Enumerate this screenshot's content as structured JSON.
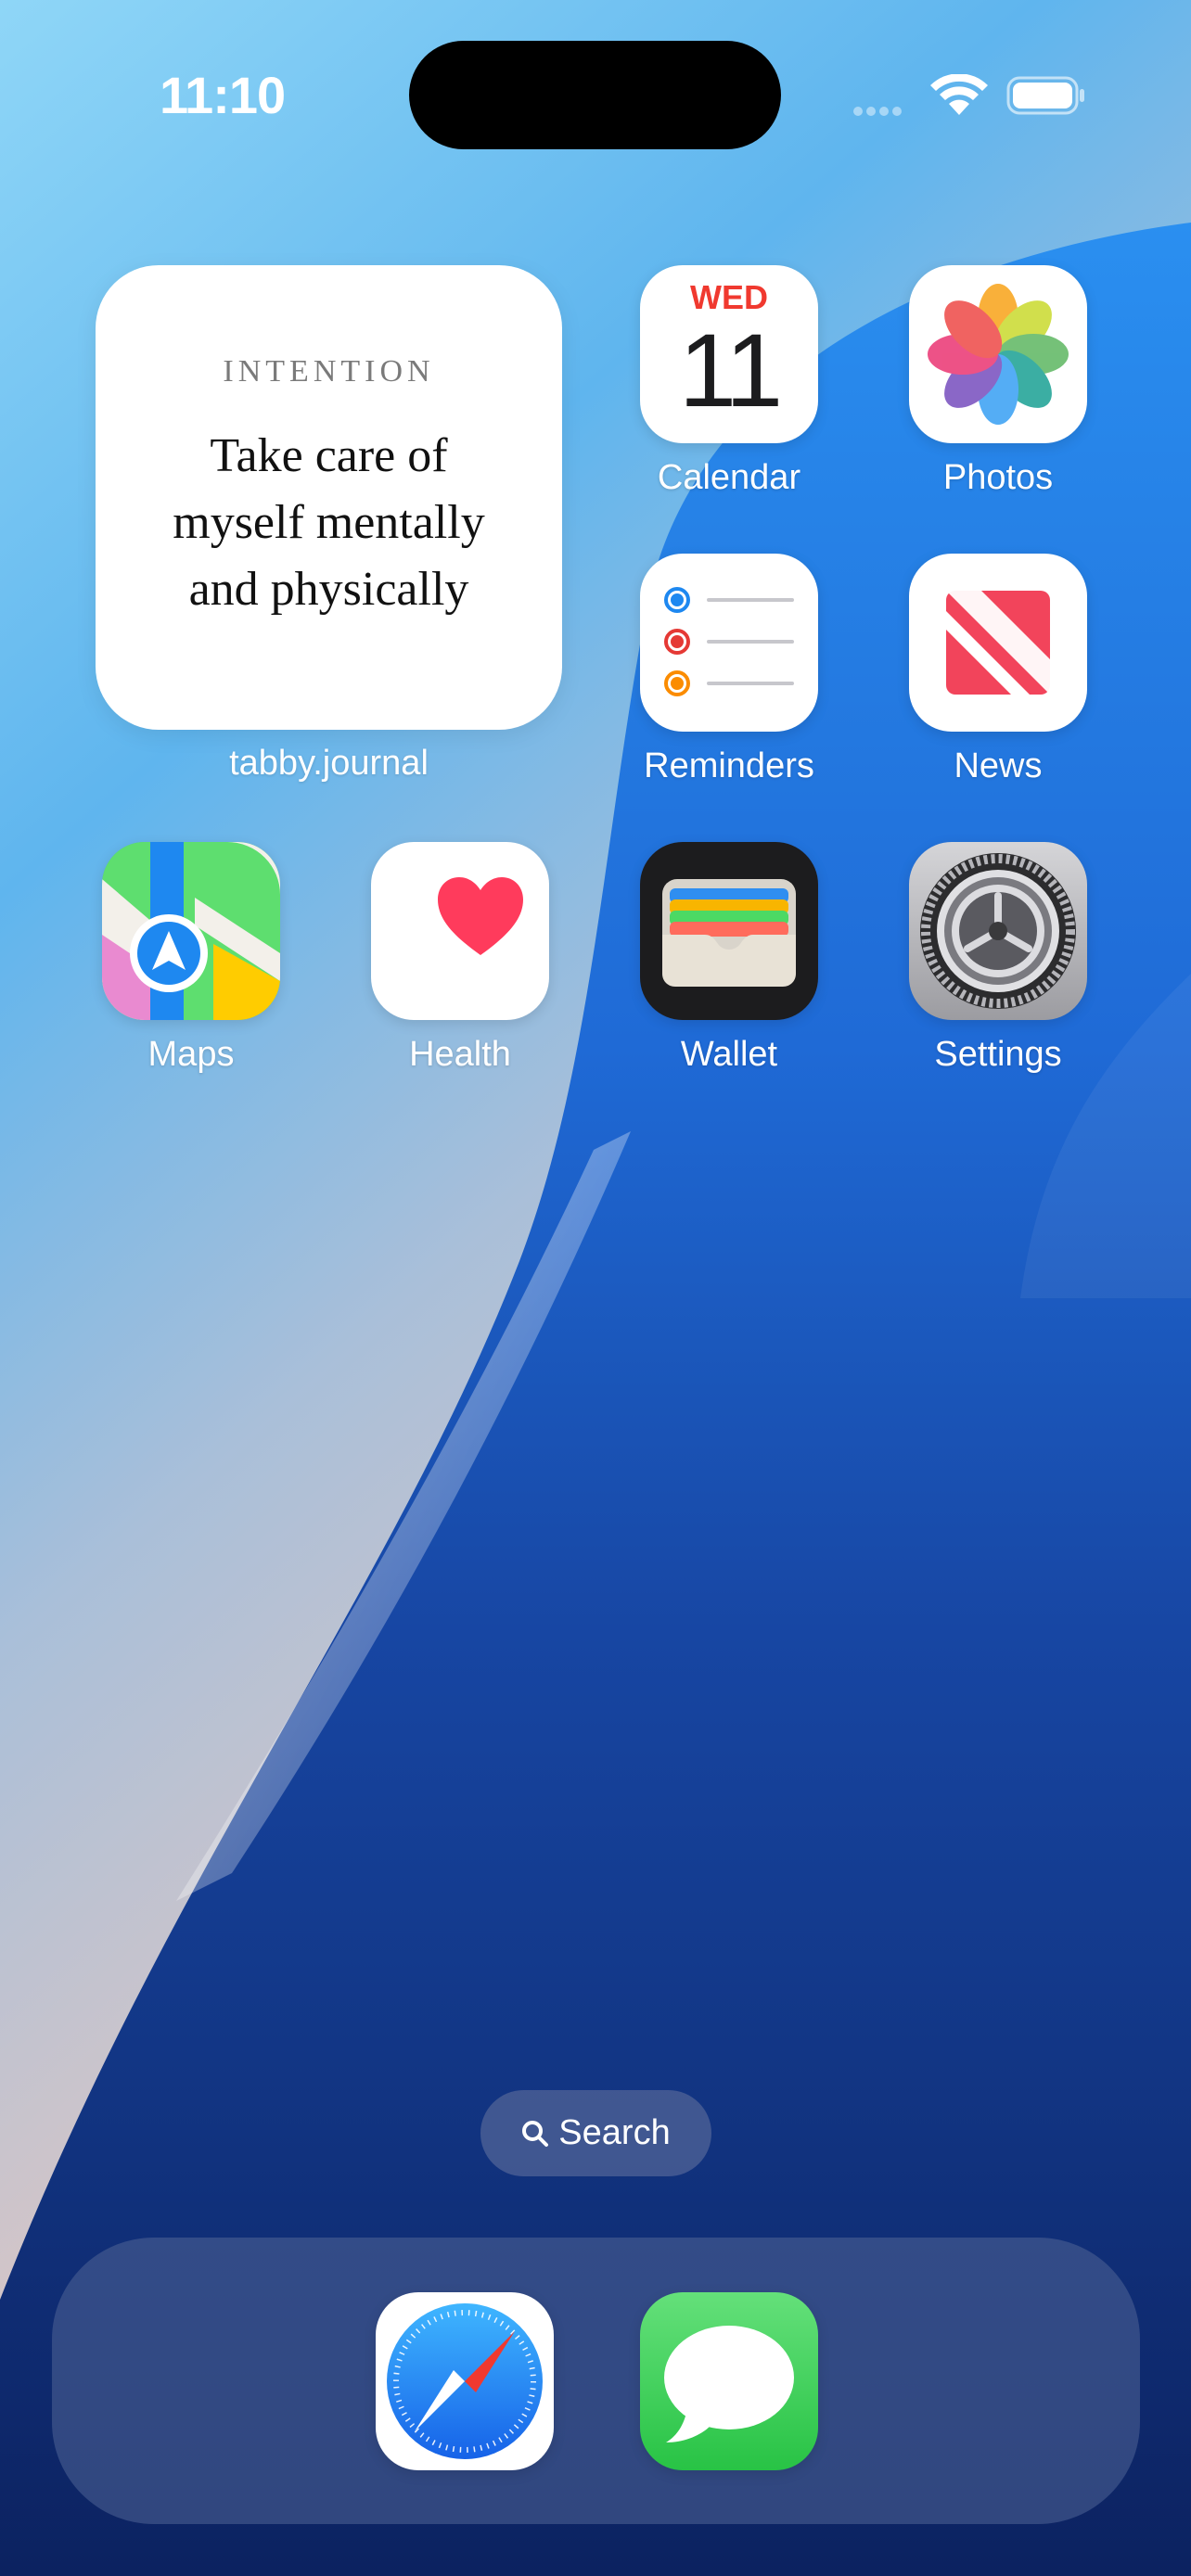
{
  "status_bar": {
    "time": "11:10"
  },
  "widget": {
    "title": "INTENTION",
    "text_lines": [
      "Take care of",
      "myself mentally",
      "and physically"
    ],
    "app_label": "tabby.journal"
  },
  "calendar": {
    "day": "WED",
    "date": "11"
  },
  "apps": {
    "calendar": "Calendar",
    "photos": "Photos",
    "reminders": "Reminders",
    "news": "News",
    "maps": "Maps",
    "health": "Health",
    "wallet": "Wallet",
    "settings": "Settings"
  },
  "search": {
    "label": "Search"
  },
  "dock": [
    "safari-icon",
    "messages-icon"
  ],
  "colors": {
    "calendar_red": "#f0392f",
    "news_red": "#f2445b",
    "health_red": "#ff3b5c",
    "messages_green": "#34c759",
    "safari_blue": "#1e88f0"
  }
}
